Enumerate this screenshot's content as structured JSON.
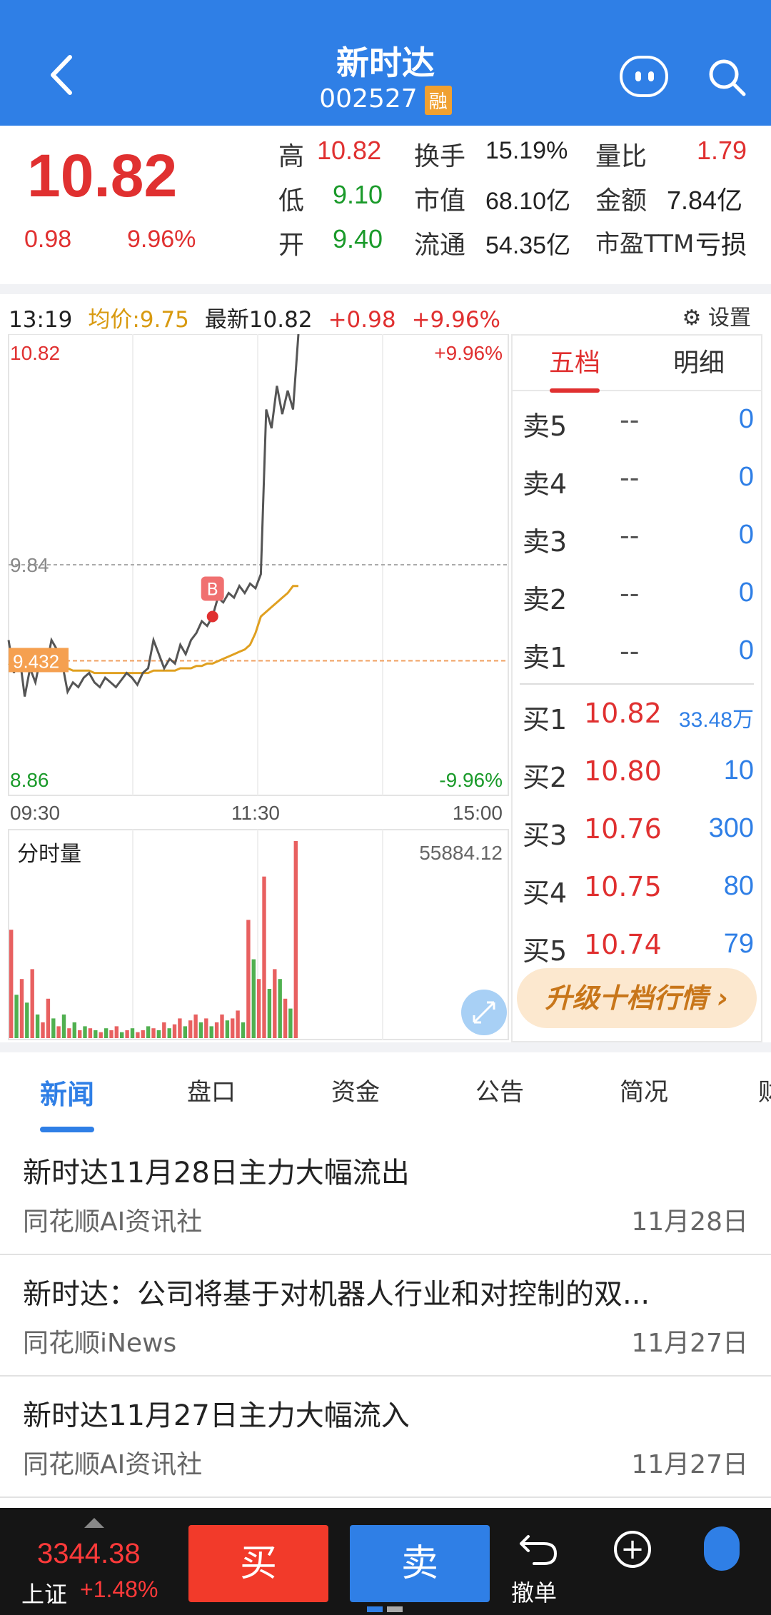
{
  "header": {
    "stock_name": "新时达",
    "stock_code": "002527",
    "badge": "融"
  },
  "quote": {
    "price": "10.82",
    "change": "0.98",
    "change_pct": "9.96%",
    "high_label": "高",
    "high": "10.82",
    "low_label": "低",
    "low": "9.10",
    "open_label": "开",
    "open": "9.40",
    "turnover_label": "换手",
    "turnover": "15.19%",
    "mktcap_label": "市值",
    "mktcap": "68.10亿",
    "float_label": "流通",
    "float_cap": "54.35亿",
    "vol_ratio_label": "量比",
    "vol_ratio": "1.79",
    "amount_label": "金额",
    "amount": "7.84亿",
    "pe_label": "市盈TTM",
    "pe": "亏损"
  },
  "chart_info": {
    "time": "13:19",
    "avg_text": "均价:9.75",
    "latest_text": "最新10.82",
    "chg": "+0.98",
    "chg_pct": "+9.96%",
    "settings": "设置"
  },
  "chart_data": {
    "type": "line",
    "title": "",
    "y_top_label": "10.82",
    "y_top_pct": "+9.96%",
    "y_bottom_label": "8.86",
    "y_bottom_pct": "-9.96%",
    "mid_label": "9.84",
    "avg_marker": "9.432",
    "x_ticks": [
      "09:30",
      "11:30",
      "15:00"
    ],
    "ylim": [
      8.86,
      10.82
    ],
    "buy_marker": "B",
    "price_series": [
      9.52,
      9.38,
      9.46,
      9.28,
      9.4,
      9.34,
      9.45,
      9.4,
      9.52,
      9.48,
      9.42,
      9.3,
      9.34,
      9.32,
      9.36,
      9.38,
      9.34,
      9.32,
      9.36,
      9.34,
      9.32,
      9.35,
      9.38,
      9.36,
      9.33,
      9.38,
      9.4,
      9.52,
      9.46,
      9.4,
      9.44,
      9.42,
      9.5,
      9.46,
      9.52,
      9.55,
      9.6,
      9.58,
      9.62,
      9.7,
      9.68,
      9.72,
      9.7,
      9.75,
      9.72,
      9.76,
      9.74,
      9.8,
      10.5,
      10.42,
      10.6,
      10.48,
      10.58,
      10.5,
      10.82
    ],
    "avg_series": [
      9.42,
      9.41,
      9.41,
      9.4,
      9.4,
      9.4,
      9.41,
      9.41,
      9.41,
      9.41,
      9.41,
      9.4,
      9.39,
      9.39,
      9.39,
      9.39,
      9.38,
      9.38,
      9.38,
      9.38,
      9.38,
      9.38,
      9.38,
      9.38,
      9.38,
      9.38,
      9.38,
      9.39,
      9.39,
      9.39,
      9.39,
      9.39,
      9.4,
      9.4,
      9.4,
      9.41,
      9.41,
      9.42,
      9.42,
      9.43,
      9.44,
      9.45,
      9.46,
      9.47,
      9.48,
      9.5,
      9.55,
      9.62,
      9.64,
      9.66,
      9.68,
      9.7,
      9.72,
      9.75,
      9.75
    ],
    "volume_label": "分时量",
    "volume_max": "55884.12",
    "volume_series": [
      0.55,
      0.22,
      0.3,
      0.18,
      0.35,
      0.12,
      0.08,
      0.2,
      0.1,
      0.06,
      0.12,
      0.05,
      0.08,
      0.04,
      0.06,
      0.05,
      0.04,
      0.03,
      0.05,
      0.04,
      0.06,
      0.03,
      0.04,
      0.05,
      0.03,
      0.04,
      0.06,
      0.05,
      0.04,
      0.08,
      0.05,
      0.07,
      0.1,
      0.06,
      0.09,
      0.12,
      0.08,
      0.1,
      0.06,
      0.08,
      0.12,
      0.09,
      0.1,
      0.14,
      0.08,
      0.6,
      0.4,
      0.3,
      0.82,
      0.25,
      0.35,
      0.3,
      0.2,
      0.15,
      1.0
    ],
    "volume_up": [
      true,
      false,
      true,
      false,
      true,
      false,
      true,
      true,
      false,
      true,
      false,
      true,
      false,
      true,
      false,
      true,
      false,
      true,
      false,
      true,
      true,
      false,
      true,
      false,
      true,
      true,
      false,
      true,
      false,
      true,
      false,
      true,
      true,
      false,
      true,
      true,
      false,
      true,
      false,
      true,
      true,
      false,
      true,
      true,
      false,
      true,
      false,
      true,
      true,
      false,
      true,
      false,
      true,
      false,
      true
    ]
  },
  "orderbook": {
    "tab1": "五档",
    "tab2": "明细",
    "sell": [
      {
        "label": "卖5",
        "price": "--",
        "vol": "0"
      },
      {
        "label": "卖4",
        "price": "--",
        "vol": "0"
      },
      {
        "label": "卖3",
        "price": "--",
        "vol": "0"
      },
      {
        "label": "卖2",
        "price": "--",
        "vol": "0"
      },
      {
        "label": "卖1",
        "price": "--",
        "vol": "0"
      }
    ],
    "buy": [
      {
        "label": "买1",
        "price": "10.82",
        "vol": "33.48万"
      },
      {
        "label": "买2",
        "price": "10.80",
        "vol": "10"
      },
      {
        "label": "买3",
        "price": "10.76",
        "vol": "300"
      },
      {
        "label": "买4",
        "price": "10.75",
        "vol": "80"
      },
      {
        "label": "买5",
        "price": "10.74",
        "vol": "79"
      }
    ],
    "upgrade": "升级十档行情 ›"
  },
  "tabs": [
    "新闻",
    "盘口",
    "资金",
    "公告",
    "简况",
    "财"
  ],
  "news": [
    {
      "title": "新时达11月28日主力大幅流出",
      "source": "同花顺AI资讯社",
      "date": "11月28日"
    },
    {
      "title": "新时达：公司将基于对机器人行业和对控制的双...",
      "source": "同花顺iNews",
      "date": "11月27日"
    },
    {
      "title": "新时达11月27日主力大幅流入",
      "source": "同花顺AI资讯社",
      "date": "11月27日"
    }
  ],
  "bottom": {
    "index_value": "3344.38",
    "index_name": "上证",
    "index_chg": "+1.48%",
    "buy": "买",
    "sell": "卖",
    "undo": "撤单"
  },
  "colors": {
    "up": "#e03030",
    "down": "#1a9a2a",
    "accent": "#2f7fe6",
    "avg_line": "#e0a020",
    "price_line": "#555555"
  }
}
